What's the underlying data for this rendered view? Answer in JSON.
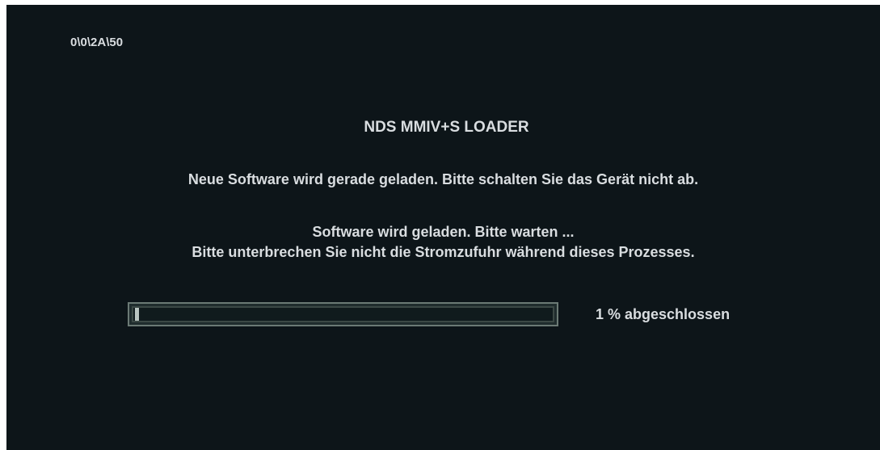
{
  "screen": {
    "code": "0\\0\\2A\\50",
    "title": "NDS MMIV+S LOADER",
    "warning": "Neue Software wird gerade geladen. Bitte schalten Sie das Gerät nicht ab.",
    "wait_line_1": "Software wird geladen. Bitte warten ...",
    "wait_line_2": "Bitte unterbrechen Sie nicht die Stromzufuhr während dieses Prozesses."
  },
  "progress": {
    "percent": 1,
    "label": "1 % abgeschlossen"
  },
  "colors": {
    "background": "#0d1519",
    "text": "#d9dde0",
    "bar_border": "#6b7a75",
    "bar_fill": "#b9c4c0"
  }
}
